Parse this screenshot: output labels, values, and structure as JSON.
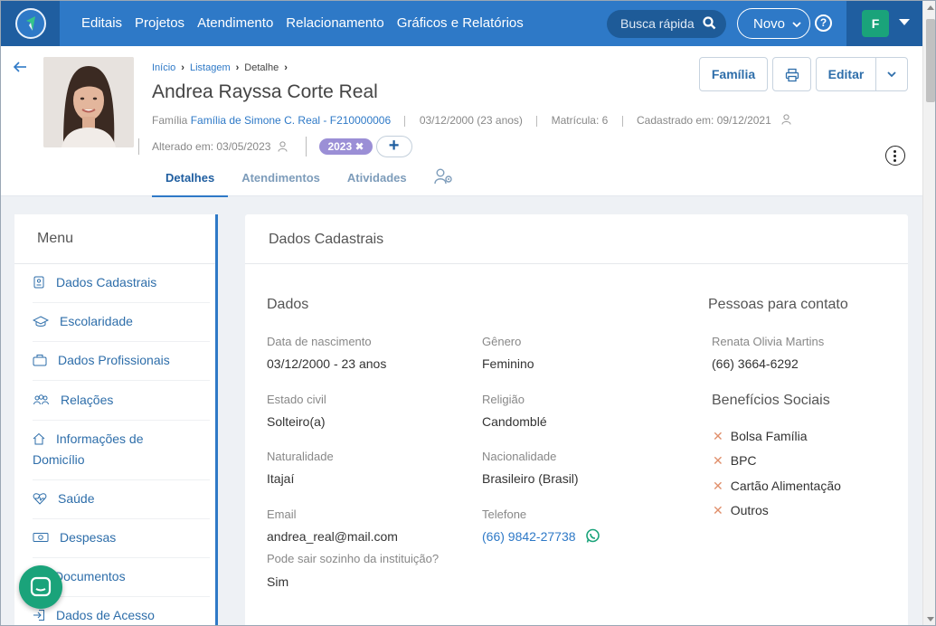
{
  "nav": {
    "items": [
      "Editais",
      "Projetos",
      "Atendimento",
      "Relacionamento",
      "Gráficos e Relatórios"
    ],
    "search_label": "Busca rápida",
    "new_label": "Novo",
    "help_label": "?",
    "user_initial": "F"
  },
  "breadcrumb": {
    "home": "Início",
    "list": "Listagem",
    "current": "Detalhe"
  },
  "person": {
    "name": "Andrea Rayssa Corte Real",
    "family_prefix": "Família",
    "family_link": "Família de Simone C. Real - F210000006",
    "birth": "03/12/2000 (23 anos)",
    "registration": "Matrícula: 6",
    "registered": "Cadastrado em: 09/12/2021",
    "altered": "Alterado em: 03/05/2023",
    "tag": "2023",
    "tag_close": "✖"
  },
  "actions": {
    "family": "Família",
    "edit": "Editar"
  },
  "tabs": [
    "Detalhes",
    "Atendimentos",
    "Atividades"
  ],
  "sidebar": {
    "title": "Menu",
    "items": [
      "Dados Cadastrais",
      "Escolaridade",
      "Dados Profissionais",
      "Relações",
      "Informações de",
      "Domicílio",
      "Saúde",
      "Despesas",
      "Documentos",
      "Dados de Acesso"
    ]
  },
  "card": {
    "title": "Dados Cadastrais",
    "section_data": "Dados",
    "section_contacts": "Pessoas para contato",
    "section_benefits": "Benefícios Sociais",
    "fields": [
      {
        "label": "Data de nascimento",
        "value": "03/12/2000 - 23 anos"
      },
      {
        "label": "Gênero",
        "value": "Feminino"
      },
      {
        "label": "Estado civil",
        "value": "Solteiro(a)"
      },
      {
        "label": "Religião",
        "value": "Candomblé"
      },
      {
        "label": "Naturalidade",
        "value": "Itajaí"
      },
      {
        "label": "Nacionalidade",
        "value": "Brasileiro (Brasil)"
      },
      {
        "label": "Email",
        "value": "andrea_real@mail.com"
      },
      {
        "label": "Telefone",
        "value": "(66) 9842-27738"
      },
      {
        "label": "Pode sair sozinho da instituição?",
        "value": "Sim"
      }
    ],
    "contact": {
      "name": "Renata Olivia Martins",
      "phone": "(66) 3664-6292"
    },
    "benefits": [
      "Bolsa Família",
      "BPC",
      "Cartão Alimentação",
      "Outros"
    ]
  },
  "colors": {
    "primary": "#2e79c7",
    "dark": "#1f5ea0",
    "green": "#1aa37a",
    "tag": "#9b8fd6",
    "x": "#e08f6b"
  }
}
